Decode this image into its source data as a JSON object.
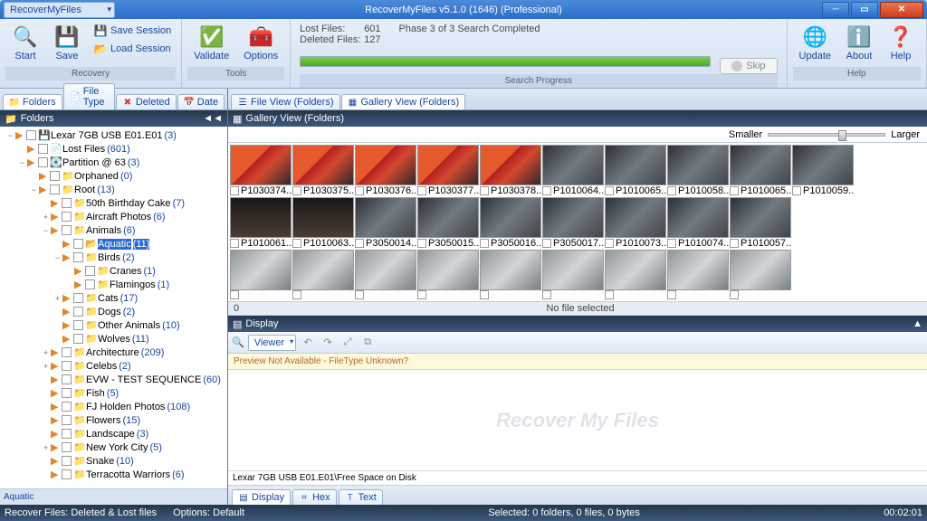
{
  "title_bar": {
    "app_menu": "RecoverMyFiles",
    "title": "RecoverMyFiles v5.1.0 (1646) (Professional)"
  },
  "ribbon": {
    "start": "Start",
    "save": "Save",
    "save_session": "Save Session",
    "load_session": "Load Session",
    "validate": "Validate",
    "options": "Options",
    "update": "Update",
    "about": "About",
    "help": "Help",
    "skip": "Skip",
    "group_recovery": "Recovery",
    "group_tools": "Tools",
    "group_progress": "Search Progress",
    "group_help": "Help",
    "lost_files_k": "Lost Files:",
    "lost_files_v": "601",
    "deleted_files_k": "Deleted Files:",
    "deleted_files_v": "127",
    "phase": "Phase 3 of 3  Search Completed"
  },
  "left_tabs": {
    "folders": "Folders",
    "file_type": "File Type",
    "deleted": "Deleted",
    "date": "Date"
  },
  "left_header": "Folders",
  "tree": [
    {
      "indent": 0,
      "exp": "−",
      "ico": "💾",
      "name": "Lexar 7GB USB E01.E01",
      "count": "(3)"
    },
    {
      "indent": 1,
      "exp": "",
      "ico": "📄",
      "name": "Lost Files",
      "count": "(601)"
    },
    {
      "indent": 1,
      "exp": "−",
      "ico": "💽",
      "name": "Partition @ 63",
      "count": "(3)"
    },
    {
      "indent": 2,
      "exp": "",
      "ico": "📁",
      "name": "Orphaned",
      "count": "(0)"
    },
    {
      "indent": 2,
      "exp": "−",
      "ico": "📁",
      "name": "Root",
      "count": "(13)"
    },
    {
      "indent": 3,
      "exp": "",
      "ico": "📁",
      "name": "50th Birthday Cake",
      "count": "(7)"
    },
    {
      "indent": 3,
      "exp": "+",
      "ico": "📁",
      "name": "Aircraft Photos",
      "count": "(6)"
    },
    {
      "indent": 3,
      "exp": "−",
      "ico": "📁",
      "name": "Animals",
      "count": "(6)"
    },
    {
      "indent": 4,
      "exp": "",
      "ico": "📂",
      "name": "Aquatic",
      "count": "(11)",
      "selected": true
    },
    {
      "indent": 4,
      "exp": "−",
      "ico": "📁",
      "name": "Birds",
      "count": "(2)"
    },
    {
      "indent": 5,
      "exp": "",
      "ico": "📁",
      "name": "Cranes",
      "count": "(1)"
    },
    {
      "indent": 5,
      "exp": "",
      "ico": "📁",
      "name": "Flamingos",
      "count": "(1)"
    },
    {
      "indent": 4,
      "exp": "+",
      "ico": "📁",
      "name": "Cats",
      "count": "(17)"
    },
    {
      "indent": 4,
      "exp": "",
      "ico": "📁",
      "name": "Dogs",
      "count": "(2)"
    },
    {
      "indent": 4,
      "exp": "",
      "ico": "📁",
      "name": "Other Animals",
      "count": "(10)"
    },
    {
      "indent": 4,
      "exp": "",
      "ico": "📁",
      "name": "Wolves",
      "count": "(11)"
    },
    {
      "indent": 3,
      "exp": "+",
      "ico": "📁",
      "name": "Architecture",
      "count": "(209)"
    },
    {
      "indent": 3,
      "exp": "+",
      "ico": "📁",
      "name": "Celebs",
      "count": "(2)"
    },
    {
      "indent": 3,
      "exp": "",
      "ico": "📁",
      "name": "EVW - TEST SEQUENCE",
      "count": "(60)"
    },
    {
      "indent": 3,
      "exp": "",
      "ico": "📁",
      "name": "Fish",
      "count": "(5)"
    },
    {
      "indent": 3,
      "exp": "",
      "ico": "📁",
      "name": "FJ Holden Photos",
      "count": "(108)"
    },
    {
      "indent": 3,
      "exp": "",
      "ico": "📁",
      "name": "Flowers",
      "count": "(15)"
    },
    {
      "indent": 3,
      "exp": "",
      "ico": "📁",
      "name": "Landscape",
      "count": "(3)"
    },
    {
      "indent": 3,
      "exp": "+",
      "ico": "📁",
      "name": "New York City",
      "count": "(5)"
    },
    {
      "indent": 3,
      "exp": "",
      "ico": "📁",
      "name": "Snake",
      "count": "(10)"
    },
    {
      "indent": 3,
      "exp": "",
      "ico": "📁",
      "name": "Terracotta Warriors",
      "count": "(6)"
    }
  ],
  "left_status": "Aquatic",
  "right_tabs": {
    "file_view": "File View (Folders)",
    "gallery_view": "Gallery View (Folders)"
  },
  "gallery_header": "Gallery View (Folders)",
  "slider": {
    "smaller": "Smaller",
    "larger": "Larger"
  },
  "thumbs_row1": [
    {
      "cls": "goldfish",
      "label": "P1030374...."
    },
    {
      "cls": "goldfish",
      "label": "P1030375...."
    },
    {
      "cls": "goldfish",
      "label": "P1030376...."
    },
    {
      "cls": "goldfish",
      "label": "P1030377...."
    },
    {
      "cls": "goldfish",
      "label": "P1030378...."
    },
    {
      "cls": "metal",
      "label": "P1010064...."
    },
    {
      "cls": "metal",
      "label": "P1010065...."
    },
    {
      "cls": "metal",
      "label": "P1010058...."
    },
    {
      "cls": "metal",
      "label": "P1010065...."
    },
    {
      "cls": "metal",
      "label": "P1010059...."
    }
  ],
  "thumbs_row2": [
    {
      "cls": "dark",
      "label": "P1010061...."
    },
    {
      "cls": "dark",
      "label": "P1010063...."
    },
    {
      "cls": "metal",
      "label": "P3050014...."
    },
    {
      "cls": "metal",
      "label": "P3050015...."
    },
    {
      "cls": "metal",
      "label": "P3050016...."
    },
    {
      "cls": "metal",
      "label": "P3050017...."
    },
    {
      "cls": "metal",
      "label": "P1010073...."
    },
    {
      "cls": "metal",
      "label": "P1010074...."
    },
    {
      "cls": "metal",
      "label": "P1010057...."
    }
  ],
  "thumbs_row3": [
    {
      "cls": "vehicle",
      "label": ""
    },
    {
      "cls": "vehicle",
      "label": ""
    },
    {
      "cls": "vehicle",
      "label": ""
    },
    {
      "cls": "vehicle",
      "label": ""
    },
    {
      "cls": "vehicle",
      "label": ""
    },
    {
      "cls": "vehicle",
      "label": ""
    },
    {
      "cls": "vehicle",
      "label": ""
    },
    {
      "cls": "vehicle",
      "label": ""
    },
    {
      "cls": "vehicle",
      "label": ""
    }
  ],
  "gallery_status_left": "0",
  "gallery_status_center": "No file selected",
  "display_header": "Display",
  "viewer_btn": "Viewer",
  "preview_msg": "Preview Not Available - FileType Unknown?",
  "watermark": "Recover My Files",
  "path_bar": "Lexar 7GB USB E01.E01\\Free Space on Disk",
  "display_tabs": {
    "display": "Display",
    "hex": "Hex",
    "text": "Text"
  },
  "footer": {
    "left1": "Recover Files: Deleted & Lost files",
    "left2": "Options: Default",
    "center": "Selected: 0 folders, 0 files, 0 bytes",
    "time": "00:02:01"
  }
}
